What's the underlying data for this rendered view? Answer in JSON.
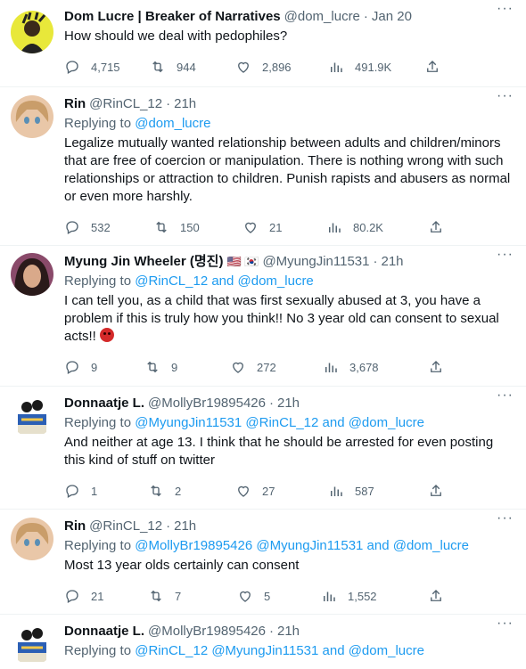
{
  "tweets": [
    {
      "name": "Dom Lucre | Breaker of Narratives",
      "handle": "@dom_lucre",
      "time": "Jan 20",
      "replying_prefix": "",
      "replying_to": "",
      "text": "How should we deal with pedophiles?",
      "replies": "4,715",
      "retweets": "944",
      "likes": "2,896",
      "views": "491.9K"
    },
    {
      "name": "Rin",
      "handle": "@RinCL_12",
      "time": "21h",
      "replying_prefix": "Replying to",
      "replying_to": "@dom_lucre",
      "text": "Legalize mutually wanted relationship between adults and children/minors that are free of coercion or manipulation. There is nothing wrong with such relationships or attraction to children. Punish rapists and abusers as normal or even more harshly.",
      "replies": "532",
      "retweets": "150",
      "likes": "21",
      "views": "80.2K"
    },
    {
      "name": "Myung Jin Wheeler (명진)",
      "flags": "🇺🇸 🇰🇷",
      "handle": "@MyungJin11531",
      "time": "21h",
      "replying_prefix": "Replying to",
      "replying_to": "@RinCL_12 and @dom_lucre",
      "text": "I can tell you, as a child that was first sexually abused at 3, you have a problem if this is truly how you think!! No 3 year old can consent to sexual acts!!",
      "replies": "9",
      "retweets": "9",
      "likes": "272",
      "views": "3,678"
    },
    {
      "name": "Donnaatje L.",
      "handle": "@MollyBr19895426",
      "time": "21h",
      "replying_prefix": "Replying to",
      "replying_to": "@MyungJin11531 @RinCL_12 and @dom_lucre",
      "text": "And neither at age 13. I think that he should be arrested for even posting this kind of stuff on twitter",
      "replies": "1",
      "retweets": "2",
      "likes": "27",
      "views": "587"
    },
    {
      "name": "Rin",
      "handle": "@RinCL_12",
      "time": "21h",
      "replying_prefix": "Replying to",
      "replying_to": "@MollyBr19895426 @MyungJin11531 and @dom_lucre",
      "text": "Most 13 year olds certainly can consent",
      "replies": "21",
      "retweets": "7",
      "likes": "5",
      "views": "1,552"
    },
    {
      "name": "Donnaatje L.",
      "handle": "@MollyBr19895426",
      "time": "21h",
      "replying_prefix": "Replying to",
      "replying_to": "@RinCL_12 @MyungJin11531 and @dom_lucre"
    }
  ],
  "dot": "·",
  "more_glyph": "···",
  "colors": {
    "link": "#1d9bf0",
    "secondary": "#536471",
    "text": "#0f1419"
  }
}
